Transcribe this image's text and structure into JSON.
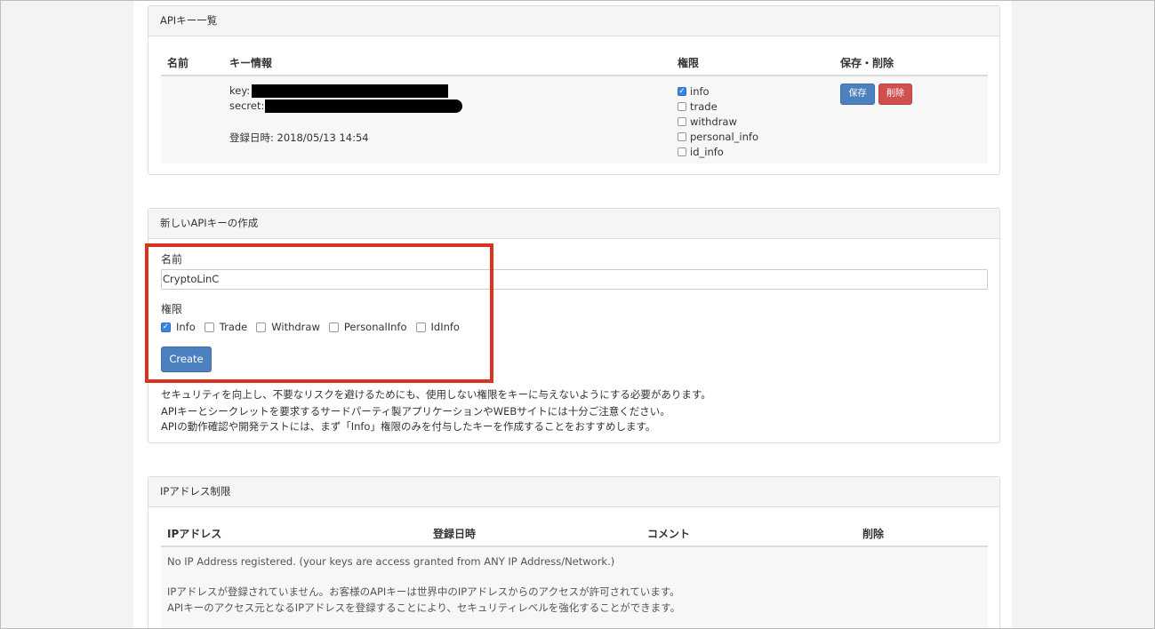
{
  "api_list": {
    "title": "APIキー一覧",
    "headers": {
      "name": "名前",
      "key_info": "キー情報",
      "permissions": "権限",
      "save_delete": "保存・削除"
    },
    "row": {
      "key_label": "key:",
      "secret_label": "secret:",
      "registered": "登録日時: 2018/05/13 14:54",
      "permissions": [
        {
          "label": "info",
          "checked": true
        },
        {
          "label": "trade",
          "checked": false
        },
        {
          "label": "withdraw",
          "checked": false
        },
        {
          "label": "personal_info",
          "checked": false
        },
        {
          "label": "id_info",
          "checked": false
        }
      ],
      "save_label": "保存",
      "delete_label": "削除"
    }
  },
  "create_key": {
    "title": "新しいAPIキーの作成",
    "name_label": "名前",
    "name_value": "CryptoLinC",
    "perm_label": "権限",
    "permissions": [
      {
        "label": "Info",
        "checked": true
      },
      {
        "label": "Trade",
        "checked": false
      },
      {
        "label": "Withdraw",
        "checked": false
      },
      {
        "label": "PersonalInfo",
        "checked": false
      },
      {
        "label": "IdInfo",
        "checked": false
      }
    ],
    "create_label": "Create",
    "notes": [
      "セキュリティを向上し、不要なリスクを避けるためにも、使用しない権限をキーに与えないようにする必要があります。",
      "APIキーとシークレットを要求するサードパーティ製アプリケーションやWEBサイトには十分ご注意ください。",
      "APIの動作確認や開発テストには、まず「Info」権限のみを付与したキーを作成することをおすすめします。"
    ]
  },
  "ip_restrict": {
    "title": "IPアドレス制限",
    "headers": {
      "ip": "IPアドレス",
      "registered": "登録日時",
      "comment": "コメント",
      "delete": "削除"
    },
    "empty_en": "No IP Address registered. (your keys are access granted from ANY IP Address/Network.)",
    "empty_ja_1": "IPアドレスが登録されていません。お客様のAPIキーは世界中のIPアドレスからのアクセスが許可されています。",
    "empty_ja_2": "APIキーのアクセス元となるIPアドレスを登録することにより、セキュリティレベルを強化することができます。"
  },
  "colors": {
    "primary_button": "#4d80bf",
    "danger_button": "#d0504d",
    "highlight_border": "#d8341f",
    "checkbox_checked": "#3b84e0"
  }
}
